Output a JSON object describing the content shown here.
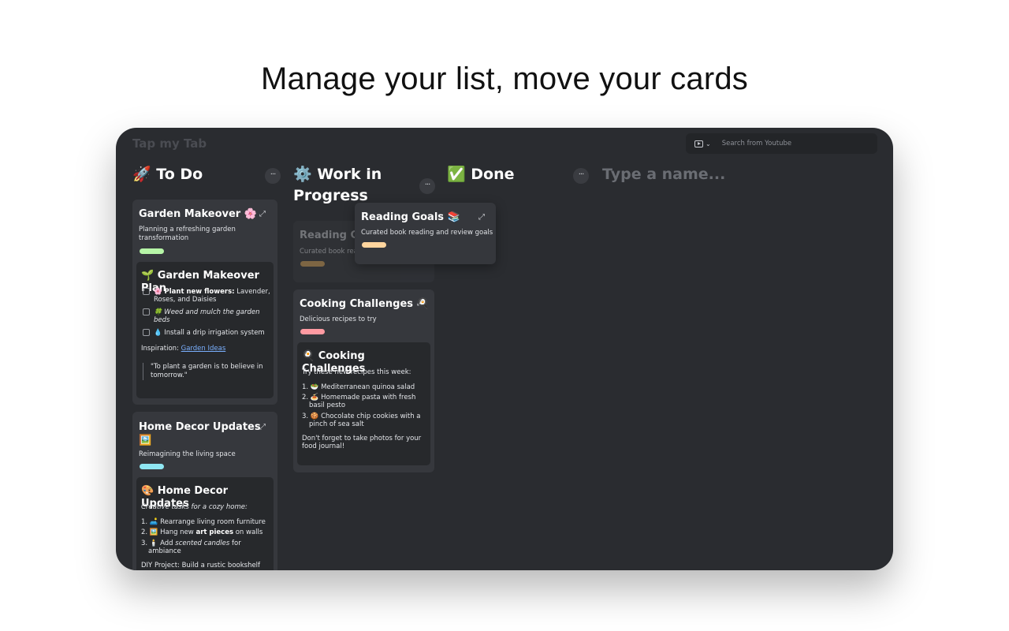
{
  "headline": "Manage your list, move your cards",
  "app": {
    "brand": "Tap my Tab",
    "search": {
      "placeholder": "Search from Youtube"
    }
  },
  "columns": {
    "todo": {
      "title": "🚀 To Do"
    },
    "wip": {
      "title_line1": "⚙️ Work in",
      "title_line2": "Progress"
    },
    "done": {
      "title": "✅ Done"
    },
    "new": {
      "placeholder": "Type a name..."
    }
  },
  "more_label": "···",
  "expand_label": "⤢",
  "garden": {
    "title": "Garden Makeover 🌸",
    "subtitle_line1": "Planning a refreshing garden",
    "subtitle_line2": "transformation",
    "pill_color": "#b6f5a7",
    "note_title": "🌱 Garden Makeover Plan",
    "task1_bold": "🌸 Plant new flowers:",
    "task1_rest": " Lavender,",
    "task1_line2": "Roses, and Daisies",
    "task2_line1": "🍀 Weed and mulch the garden",
    "task2_line2": "beds",
    "task3": "💧 Install a drip irrigation system",
    "inspiration_label": "Inspiration: ",
    "inspiration_link": "Garden Ideas",
    "quote_line1": "\"To plant a garden is to believe in",
    "quote_line2": "tomorrow.\""
  },
  "home": {
    "title_line1": "Home Decor Updates",
    "title_line2": "🖼️",
    "subtitle": "Reimagining the living space",
    "pill_color": "#8fe6f2",
    "note_title": "🎨 Home Decor Updates",
    "intro": "Creative tasks for a cozy home:",
    "item1": "1. 🛋️ Rearrange living room furniture",
    "item2_pre": "2. 🖼️ Hang new ",
    "item2_bold": "art pieces",
    "item2_post": " on walls",
    "item3_pre": "3. 🕯️ Add ",
    "item3_em": "scented candles",
    "item3_post": " for",
    "item3_line2": "ambiance",
    "diy": "DIY Project: Build a rustic bookshelf with"
  },
  "reading_ghost": {
    "title": "Reading Go",
    "subtitle": "Curated book reac",
    "pill_color": "#e2ab5a"
  },
  "reading_drag": {
    "title": "Reading Goals 📚",
    "subtitle": "Curated book reading and review goals",
    "pill_color": "#ffd59e"
  },
  "cooking": {
    "title": "Cooking Challenges 🍳",
    "subtitle": "Delicious recipes to try",
    "pill_color": "#ff9aa2",
    "note_title": "🍳 Cooking Challenges",
    "intro": "Try these new recipes this week:",
    "item1": "1. 🥗 Mediterranean quinoa salad",
    "item2_line1": "2. 🍝 Homemade pasta with fresh",
    "item2_line2": "basil pesto",
    "item3_line1": "3. 🍪 Chocolate chip cookies with a",
    "item3_line2": "pinch of sea salt",
    "footer_line1": "Don't forget to take photos for your",
    "footer_line2": "food journal!"
  }
}
